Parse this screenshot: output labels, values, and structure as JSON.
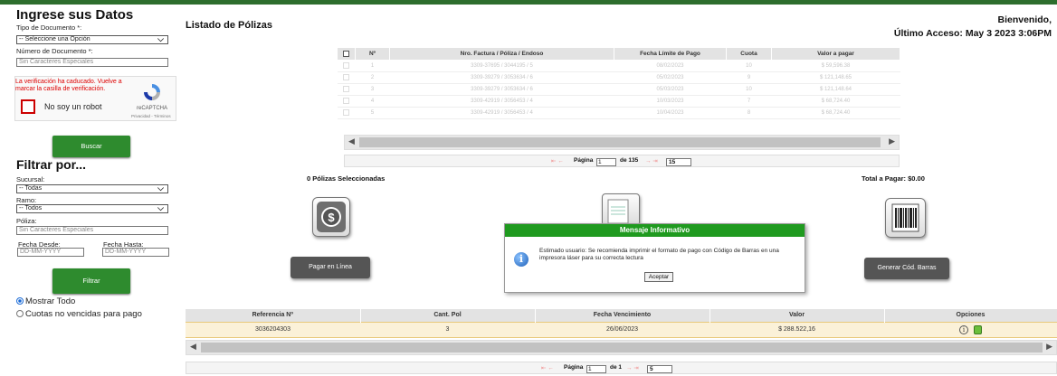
{
  "left": {
    "heading": "Ingrese sus Datos",
    "tipo_doc_label": "Tipo de Documento *:",
    "tipo_doc_value": "-- Seleccione una Opción",
    "numero_doc_label": "Número de Documento *:",
    "numero_doc_placeholder": "Sin Caracteres Especiales",
    "captcha_error": "La verificación ha caducado. Vuelve a marcar la casilla de verificación.",
    "captcha_label": "No soy un robot",
    "captcha_brand": "reCAPTCHA",
    "captcha_links": "Privacidad - Términos",
    "buscar": "Buscar",
    "filter_heading": "Filtrar por...",
    "sucursal_label": "Sucursal:",
    "sucursal_value": "-- Todas",
    "ramo_label": "Ramo:",
    "ramo_value": "-- Todos",
    "poliza_label": "Póliza:",
    "poliza_placeholder": "Sin Caracteres Especiales",
    "fecha_desde_label": "Fecha Desde:",
    "fecha_desde_placeholder": "DD-MM-YYYY",
    "fecha_hasta_label": "Fecha Hasta:",
    "fecha_hasta_placeholder": "DD-MM-YYYY",
    "filtrar": "Filtrar",
    "radio_todo": "Mostrar Todo",
    "radio_cuotas": "Cuotas no vencidas para pago"
  },
  "header": {
    "title": "Listado de Pólizas",
    "welcome": "Bienvenido,",
    "last_access": "Último Acceso: May 3 2023 3:06PM"
  },
  "polizas": {
    "columns": [
      "Nº",
      "Nro. Factura / Póliza / Endoso",
      "Fecha Límite de Pago",
      "Cuota",
      "Valor a pagar"
    ],
    "rows": [
      [
        "1",
        "3309-37695 / 3044195 / 5",
        "08/02/2023",
        "10",
        "$ 59,596.38"
      ],
      [
        "2",
        "3309-39279 / 3053634 / 6",
        "05/02/2023",
        "9",
        "$ 121,148.65"
      ],
      [
        "3",
        "3309-39279 / 3053634 / 6",
        "05/03/2023",
        "10",
        "$ 121,148.64"
      ],
      [
        "4",
        "3309-42919 / 3056453 / 4",
        "10/03/2023",
        "7",
        "$ 68,724.40"
      ],
      [
        "5",
        "3309-42919 / 3056453 / 4",
        "10/04/2023",
        "8",
        "$ 68,724.40"
      ]
    ],
    "pager": {
      "page_label": "Página",
      "page": "1",
      "of": "de 135",
      "per_page": "15"
    }
  },
  "summary": {
    "selected": "0  Pólizas Seleccionadas",
    "total": "Total a Pagar: $0.00",
    "pagar_en_linea": "Pagar en Línea",
    "generar": "Generar Cód. Barras"
  },
  "modal": {
    "title": "Mensaje Informativo",
    "message": "Estimado usuario: Se recomienda imprimir el formato de pago con Código de Barras en una impresora láser para su correcta lectura",
    "button": "Aceptar"
  },
  "referencias": {
    "columns": [
      "Referencia Nº",
      "Cant. Pol",
      "Fecha Vencimiento",
      "Valor",
      "Opciones"
    ],
    "row": [
      "3036204303",
      "3",
      "26/06/2023",
      "$ 288.522,16"
    ],
    "pager": {
      "page_label": "Página",
      "page": "1",
      "of": "de 1",
      "per_page": "5"
    }
  }
}
